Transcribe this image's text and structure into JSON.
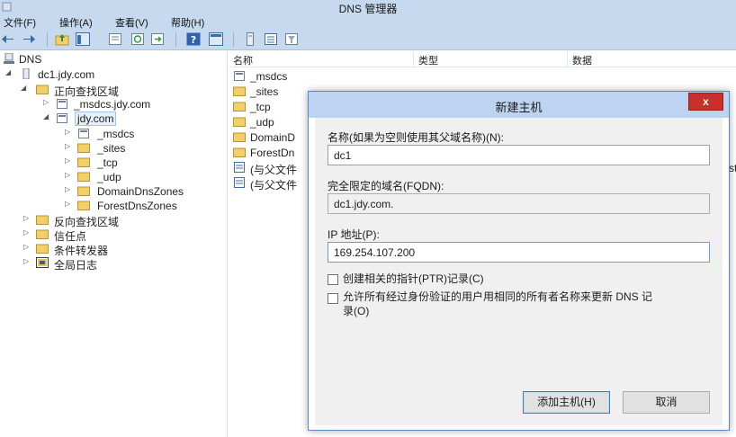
{
  "window": {
    "title": "DNS 管理器"
  },
  "menu": [
    "文件(F)",
    "操作(A)",
    "查看(V)",
    "帮助(H)"
  ],
  "tree": {
    "root": "DNS",
    "server": "dc1.jdy.com",
    "forward_zones": "正向查找区域",
    "zone_msdcs": "_msdcs.jdy.com",
    "zone_jdy": "jdy.com",
    "sub_msdcs": "_msdcs",
    "sub_sites": "_sites",
    "sub_tcp": "_tcp",
    "sub_udp": "_udp",
    "sub_domaindns": "DomainDnsZones",
    "sub_forestdns": "ForestDnsZones",
    "reverse_zones": "反向查找区域",
    "trust_points": "信任点",
    "conditional_forwarders": "条件转发器",
    "global_logs": "全局日志"
  },
  "list": {
    "columns": [
      "名称",
      "类型",
      "数据"
    ],
    "rows": [
      "_msdcs",
      "_sites",
      "_tcp",
      "_udp",
      "DomainD",
      "ForestDn",
      "(与父文件",
      "(与父文件"
    ],
    "edge_fragment": "st"
  },
  "dialog": {
    "title": "新建主机",
    "close_label": "x",
    "name_label": "名称(如果为空则使用其父域名称)(N):",
    "name_value": "dc1",
    "fqdn_label": "完全限定的域名(FQDN):",
    "fqdn_value": "dc1.jdy.com.",
    "ip_label": "IP 地址(P):",
    "ip_value": "169.254.107.200",
    "ptr_label": "创建相关的指针(PTR)记录(C)",
    "allow_label_1": "允许所有经过身份验证的用户用相同的所有者名称来更新 DNS 记",
    "allow_label_2": "录(O)",
    "add_button": "添加主机(H)",
    "cancel_button": "取消"
  },
  "colors": {
    "chrome": "#c7d9ee",
    "dialog_title": "#bcd4ef",
    "close_red": "#c7302b",
    "folder": "#f2cf6b"
  }
}
